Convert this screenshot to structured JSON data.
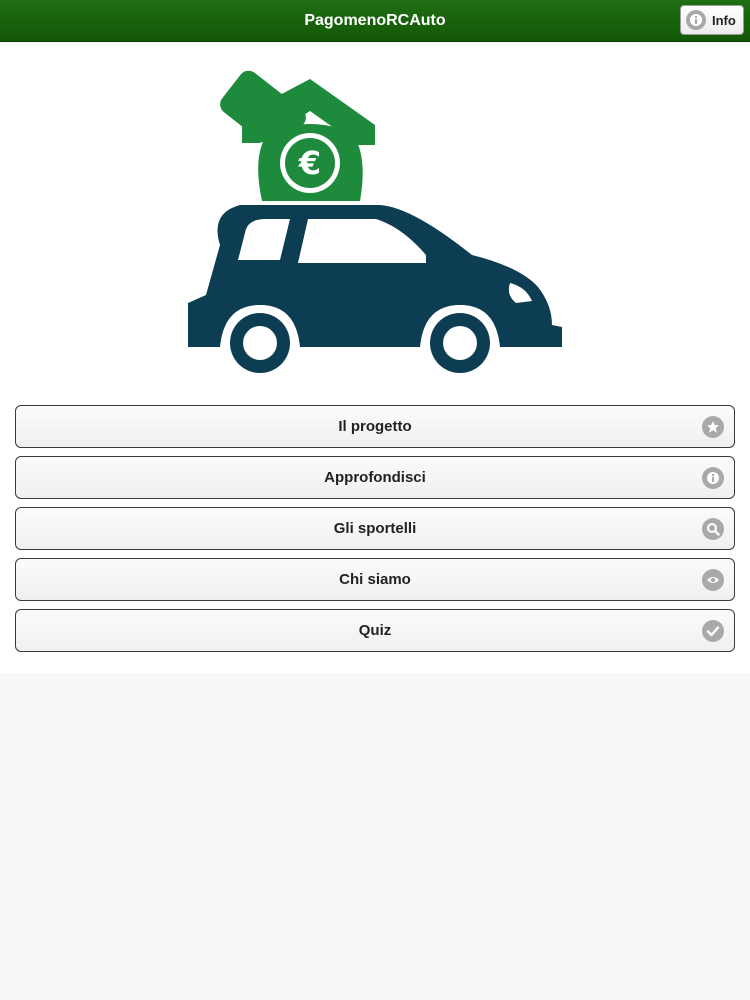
{
  "header": {
    "title": "PagomenoRCAuto",
    "info_label": "Info"
  },
  "logo": {
    "icon": "car-euro-logo",
    "colors": {
      "car": "#0c3d52",
      "money_bag": "#1d8a3c"
    }
  },
  "menu": {
    "items": [
      {
        "label": "Il progetto",
        "icon": "star-icon"
      },
      {
        "label": "Approfondisci",
        "icon": "info-icon"
      },
      {
        "label": "Gli sportelli",
        "icon": "search-icon"
      },
      {
        "label": "Chi siamo",
        "icon": "eye-icon"
      },
      {
        "label": "Quiz",
        "icon": "check-icon"
      }
    ]
  },
  "colors": {
    "header_bg": "#175f0c",
    "icon_gray": "#a9a9a9"
  }
}
